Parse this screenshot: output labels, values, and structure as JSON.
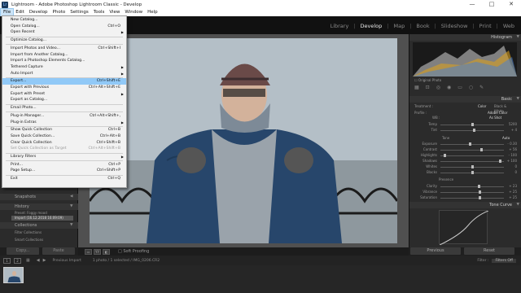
{
  "window": {
    "title": "Lightroom - Adobe Photoshop Lightroom Classic - Develop",
    "app_icon_text": "Lr",
    "minimize": "—",
    "maximize": "□",
    "close": "✕"
  },
  "menubar": [
    "File",
    "Edit",
    "Develop",
    "Photo",
    "Settings",
    "Tools",
    "View",
    "Window",
    "Help"
  ],
  "modules": [
    "Library",
    "Develop",
    "Map",
    "Book",
    "Slideshow",
    "Print",
    "Web"
  ],
  "active_module": "Develop",
  "file_menu": [
    {
      "label": "New Catalog...",
      "shortcut": "",
      "sub": false,
      "disabled": false
    },
    {
      "label": "Open Catalog...",
      "shortcut": "Ctrl+O",
      "sub": false,
      "disabled": false
    },
    {
      "label": "Open Recent",
      "shortcut": "",
      "sub": true,
      "disabled": false
    },
    {
      "sep": true
    },
    {
      "label": "Optimize Catalog...",
      "shortcut": "",
      "sub": false,
      "disabled": false
    },
    {
      "sep": true
    },
    {
      "label": "Import Photos and Video...",
      "shortcut": "Ctrl+Shift+I",
      "sub": false,
      "disabled": false
    },
    {
      "label": "Import from Another Catalog...",
      "shortcut": "",
      "sub": false,
      "disabled": false
    },
    {
      "label": "Import a Photoshop Elements Catalog...",
      "shortcut": "",
      "sub": false,
      "disabled": false
    },
    {
      "label": "Tethered Capture",
      "shortcut": "",
      "sub": true,
      "disabled": false
    },
    {
      "label": "Auto Import",
      "shortcut": "",
      "sub": true,
      "disabled": false
    },
    {
      "sep": true
    },
    {
      "label": "Export...",
      "shortcut": "Ctrl+Shift+E",
      "sub": false,
      "disabled": false,
      "highlight": true
    },
    {
      "label": "Export with Previous",
      "shortcut": "Ctrl+Alt+Shift+E",
      "sub": false,
      "disabled": false
    },
    {
      "label": "Export with Preset",
      "shortcut": "",
      "sub": true,
      "disabled": false
    },
    {
      "label": "Export as Catalog...",
      "shortcut": "",
      "sub": false,
      "disabled": false
    },
    {
      "sep": true
    },
    {
      "label": "Email Photo...",
      "shortcut": "",
      "sub": false,
      "disabled": false
    },
    {
      "sep": true
    },
    {
      "label": "Plug-in Manager...",
      "shortcut": "Ctrl+Alt+Shift+,",
      "sub": false,
      "disabled": false
    },
    {
      "label": "Plug-in Extras",
      "shortcut": "",
      "sub": true,
      "disabled": false
    },
    {
      "sep": true
    },
    {
      "label": "Show Quick Collection",
      "shortcut": "Ctrl+B",
      "sub": false,
      "disabled": false
    },
    {
      "label": "Save Quick Collection...",
      "shortcut": "Ctrl+Alt+B",
      "sub": false,
      "disabled": false
    },
    {
      "label": "Clear Quick Collection",
      "shortcut": "Ctrl+Shift+B",
      "sub": false,
      "disabled": false
    },
    {
      "label": "Set Quick Collection as Target",
      "shortcut": "Ctrl+Alt+Shift+B",
      "sub": false,
      "disabled": true
    },
    {
      "sep": true
    },
    {
      "label": "Library Filters",
      "shortcut": "",
      "sub": true,
      "disabled": false
    },
    {
      "sep": true
    },
    {
      "label": "Print...",
      "shortcut": "Ctrl+P",
      "sub": false,
      "disabled": false
    },
    {
      "label": "Page Setup...",
      "shortcut": "Ctrl+Shift+P",
      "sub": false,
      "disabled": false
    },
    {
      "sep": true
    },
    {
      "label": "Exit",
      "shortcut": "Ctrl+Q",
      "sub": false,
      "disabled": false
    }
  ],
  "left_panel": {
    "snapshots": "Snapshots",
    "history": "History",
    "history_items": [
      "Preset: Foggy mood",
      "Import (16.12.2018 16:09:09)"
    ],
    "collections": "Collections",
    "collection_items": [
      "Filter Collections",
      "Smart Collections"
    ],
    "copy_btn": "Copy...",
    "paste_btn": "Paste"
  },
  "right_panel": {
    "histogram": "Histogram",
    "original_photo": "Original Photo",
    "basic": "Basic",
    "treatment": "Treatment :",
    "color": "Color",
    "bw": "Black & White",
    "profile": "Profile :",
    "profile_val": "Adobe Color",
    "wb": "WB :",
    "wb_val": "As Shot",
    "tone": "Tone",
    "tone_auto": "Auto",
    "presence": "Presence",
    "sliders_wb": [
      {
        "label": "Temp",
        "value": "5200",
        "pos": 0.5
      },
      {
        "label": "Tint",
        "value": "+ 4",
        "pos": 0.52
      }
    ],
    "sliders_tone": [
      {
        "label": "Exposure",
        "value": "- 0.30",
        "pos": 0.46
      },
      {
        "label": "Contrast",
        "value": "+ 56",
        "pos": 0.64
      },
      {
        "label": "Highlights",
        "value": "- 100",
        "pos": 0.05
      },
      {
        "label": "Shadows",
        "value": "+ 100",
        "pos": 0.95
      },
      {
        "label": "Whites",
        "value": "0",
        "pos": 0.5
      },
      {
        "label": "Blacks",
        "value": "0",
        "pos": 0.5
      }
    ],
    "sliders_presence": [
      {
        "label": "Clarity",
        "value": "+ 23",
        "pos": 0.6
      },
      {
        "label": "Vibrance",
        "value": "+ 25",
        "pos": 0.62
      },
      {
        "label": "Saturation",
        "value": "+ 25",
        "pos": 0.62
      }
    ],
    "tone_curve": "Tone Curve",
    "previous_btn": "Previous",
    "reset_btn": "Reset"
  },
  "toolbar": {
    "soft_proofing": "Soft Proofing"
  },
  "filmstrip": {
    "page1": "1",
    "page2": "2",
    "source": "Previous Import",
    "status": "1 photo / 1 selected / IMG_0206.CR2",
    "filter_label": "Filter :",
    "filter_value": "Filters Off"
  },
  "colors": {
    "menu_highlight": "#91c9f7",
    "panel_bg": "#2b2b2b",
    "active_module": "#e8e8e8"
  }
}
